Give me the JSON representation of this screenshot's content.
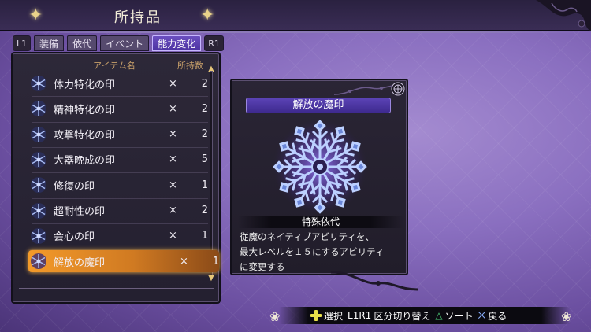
{
  "header": {
    "title": "所持品"
  },
  "tabs": [
    {
      "label": "L1",
      "kind": "shoulder"
    },
    {
      "label": "装備",
      "kind": "tab"
    },
    {
      "label": "依代",
      "kind": "tab"
    },
    {
      "label": "イベント",
      "kind": "tab"
    },
    {
      "label": "能力変化",
      "kind": "tab",
      "active": true
    },
    {
      "label": "R1",
      "kind": "shoulder"
    }
  ],
  "list": {
    "header_name": "アイテム名",
    "header_count": "所持数",
    "times_symbol": "×",
    "items": [
      {
        "name": "体力特化の印",
        "qty": "2"
      },
      {
        "name": "精神特化の印",
        "qty": "2"
      },
      {
        "name": "攻撃特化の印",
        "qty": "2"
      },
      {
        "name": "大器晩成の印",
        "qty": "5"
      },
      {
        "name": "修復の印",
        "qty": "1"
      },
      {
        "name": "超耐性の印",
        "qty": "2"
      },
      {
        "name": "会心の印",
        "qty": "1"
      },
      {
        "name": "解放の魔印",
        "qty": "1",
        "selected": true
      }
    ]
  },
  "detail": {
    "name": "解放の魔印",
    "category": "特殊依代",
    "description_lines": [
      "従魔のネイティブアビリティを、",
      "最大レベルを１５にするアビリティ",
      "に変更する"
    ]
  },
  "controls": {
    "select": "選択",
    "switch_key": "L1R1",
    "switch": "区分切り替え",
    "sort": "ソート",
    "back": "戻る"
  },
  "colors": {
    "accent_orange": "#f39a2a",
    "tab_active": "#5b43b5",
    "background": "#8a6fc0"
  }
}
